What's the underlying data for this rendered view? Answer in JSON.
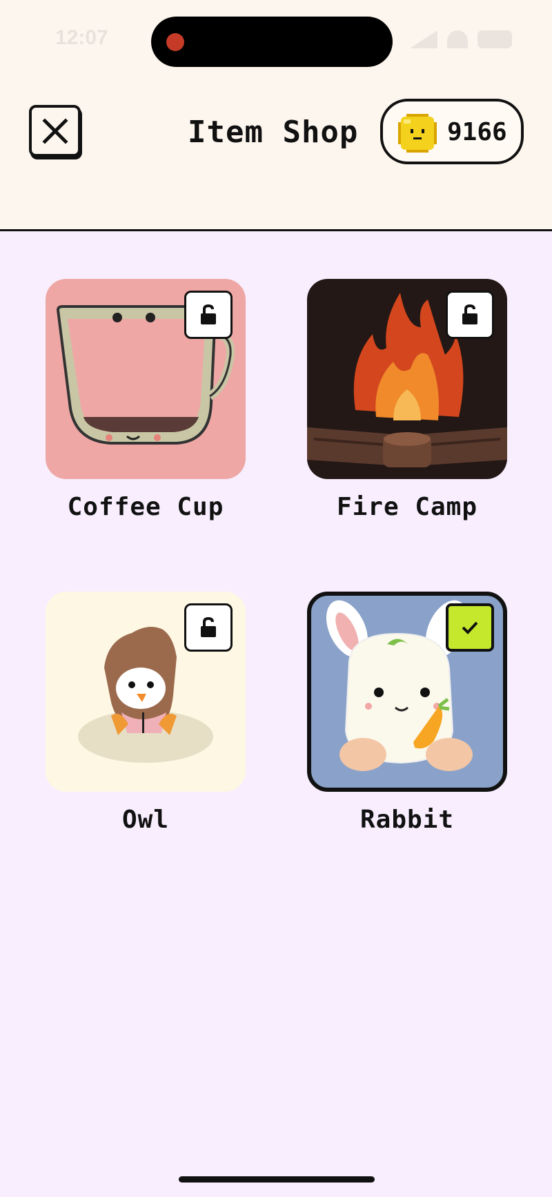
{
  "status_bar": {
    "time": "12:07"
  },
  "header": {
    "title": "Item Shop",
    "coins": "9166"
  },
  "items": [
    {
      "name": "Coffee Cup",
      "state": "locked",
      "bg": "#eea7a5"
    },
    {
      "name": "Fire Camp",
      "state": "locked",
      "bg": "#231815"
    },
    {
      "name": "Owl",
      "state": "locked",
      "bg": "#fdf7e3"
    },
    {
      "name": "Rabbit",
      "state": "owned",
      "bg": "#8aa2c9"
    }
  ],
  "icons": {
    "close": "close-icon",
    "coin": "coin-icon",
    "lock": "unlocked-padlock-icon",
    "check": "checkmark-icon"
  },
  "colors": {
    "accent_check": "#c5e82d",
    "header_bg": "#fdf6ef",
    "page_bg": "#f8eefe"
  }
}
